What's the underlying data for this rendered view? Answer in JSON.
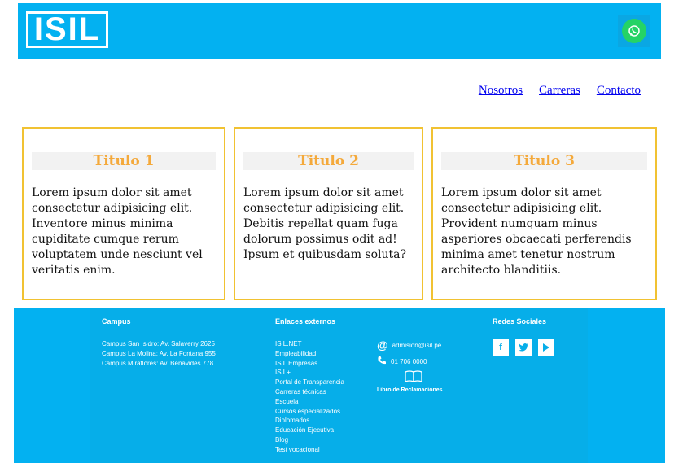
{
  "header": {
    "logo_text": "ISIL",
    "whatsapp_icon": "whatsapp-icon"
  },
  "nav": {
    "items": [
      "Nosotros",
      "Carreras",
      "Contacto"
    ]
  },
  "cards": [
    {
      "title": "Titulo 1",
      "body": "Lorem ipsum dolor sit amet consectetur adipisicing elit. Inventore minus minima cupiditate cumque rerum voluptatem unde nesciunt vel veritatis enim."
    },
    {
      "title": "Titulo 2",
      "body": "Lorem ipsum dolor sit amet consectetur adipisicing elit. Debitis repellat quam fuga dolorum possimus odit ad! Ipsum et quibusdam soluta?"
    },
    {
      "title": "Titulo 3",
      "body": "Lorem ipsum dolor sit amet consectetur adipisicing elit. Provident numquam minus asperiores obcaecati perferendis minima amet tenetur nostrum architecto blanditiis."
    }
  ],
  "footer": {
    "campus_heading": "Campus",
    "campus_items": [
      "Campus San Isidro: Av. Salaverry 2625",
      "Campus La Molina: Av. La Fontana 955",
      "Campus Miraflores: Av. Benavides 778"
    ],
    "links_heading": "Enlaces externos",
    "links": [
      "ISIL.NET",
      "Empleabilidad",
      "ISIL Empresas",
      "ISIL+",
      "Portal de Transparencia",
      "Carreras técnicas",
      "Escuela",
      "Cursos especializados",
      "Diplomados",
      "Educación Ejecutiva",
      "Blog",
      "Test vocacional"
    ],
    "email": "admision@isil.pe",
    "phone": "01 706 0000",
    "complaints_book": "Libro de Reclamaciones",
    "social_heading": "Redes Sociales",
    "social_icons": [
      "facebook-icon",
      "twitter-icon",
      "youtube-icon"
    ]
  },
  "colors": {
    "brand_blue": "#03b1f1",
    "card_border": "#f1c232",
    "title_orange": "#f4a93b",
    "whatsapp_green": "#25d366"
  }
}
